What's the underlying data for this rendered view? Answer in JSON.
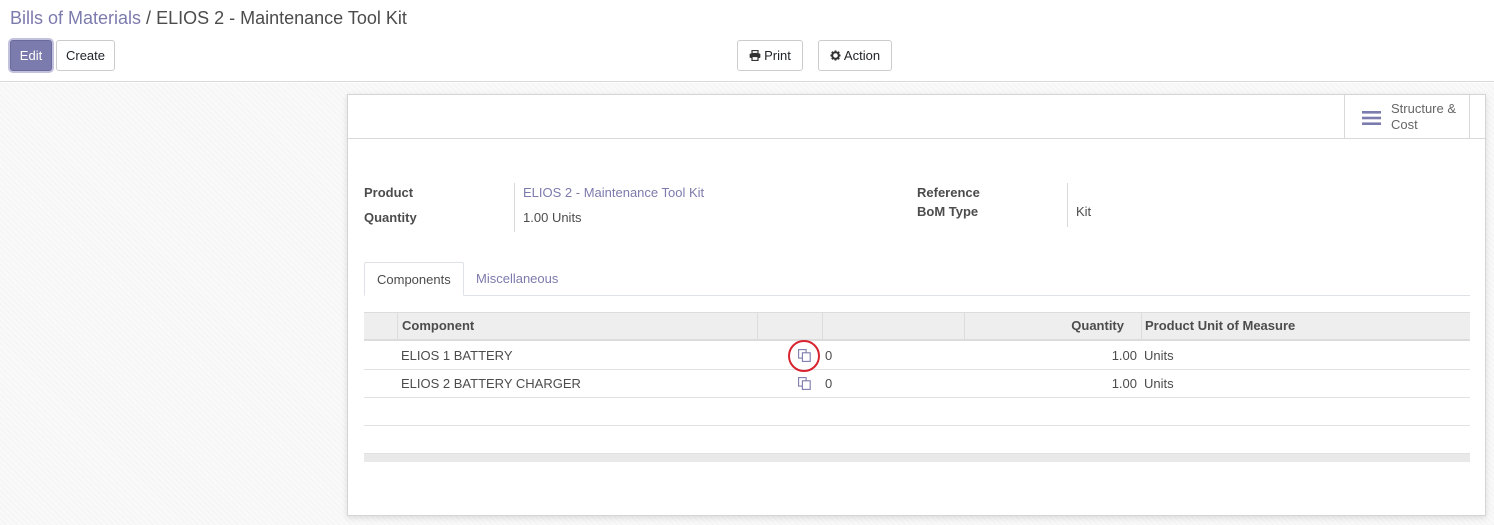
{
  "breadcrumb": {
    "parent": "Bills of Materials",
    "separator": "/",
    "current": "ELIOS 2 - Maintenance Tool Kit"
  },
  "toolbar": {
    "edit_label": "Edit",
    "create_label": "Create",
    "print_label": "Print",
    "action_label": "Action"
  },
  "smart_button": {
    "label": "Structure & Cost",
    "icon": "bars-icon"
  },
  "form": {
    "product_label": "Product",
    "product_value": "ELIOS 2 - Maintenance Tool Kit",
    "quantity_label": "Quantity",
    "quantity_value": "1.00",
    "quantity_uom": "Units",
    "reference_label": "Reference",
    "reference_value": "",
    "bom_type_label": "BoM Type",
    "bom_type_value": "Kit"
  },
  "tabs": [
    {
      "label": "Components",
      "active": true
    },
    {
      "label": "Miscellaneous",
      "active": false
    }
  ],
  "table": {
    "headers": {
      "component": "Component",
      "icon_col": "",
      "blank_col": "",
      "quantity": "Quantity",
      "uom": "Product Unit of Measure"
    },
    "rows": [
      {
        "component": "ELIOS 1 BATTERY",
        "count": "0",
        "quantity": "1.00",
        "uom": "Units",
        "icon": "copy-icon",
        "highlighted": true
      },
      {
        "component": "ELIOS 2 BATTERY CHARGER",
        "count": "0",
        "quantity": "1.00",
        "uom": "Units",
        "icon": "copy-icon",
        "highlighted": false
      }
    ]
  },
  "colors": {
    "accent": "#7c7bad",
    "highlight_ring": "#d9232e"
  }
}
